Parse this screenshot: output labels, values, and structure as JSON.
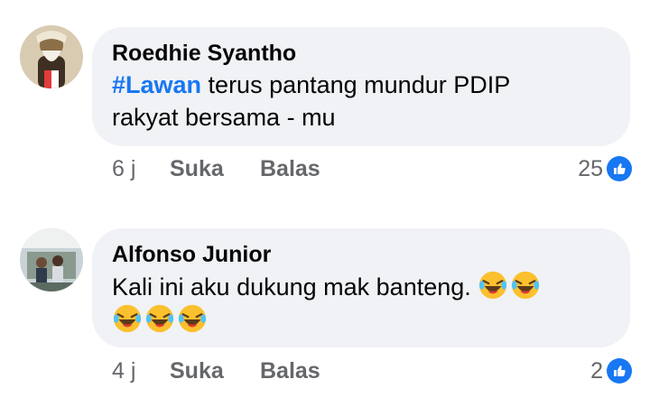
{
  "comments": [
    {
      "author": "Roedhie Syantho",
      "hashtag": "#Lawan",
      "text_line1": " terus pantang mundur PDIP",
      "text_line2": "rakyat bersama - mu",
      "time": "6 j",
      "like_label": "Suka",
      "reply_label": "Balas",
      "reaction_count": "25",
      "reaction_icon": "like-icon"
    },
    {
      "author": "Alfonso Junior",
      "text_line1": "Kali ini aku dukung mak banteng.",
      "time": "4 j",
      "like_label": "Suka",
      "reply_label": "Balas",
      "reaction_count": "2",
      "reaction_icon": "like-icon",
      "emojis": [
        "laughing-crying-emoji",
        "laughing-crying-emoji",
        "laughing-crying-emoji",
        "laughing-crying-emoji",
        "laughing-crying-emoji"
      ]
    }
  ],
  "colors": {
    "bubble": "#f0f2f5",
    "hashtag": "#1877f2",
    "meta": "#65676b",
    "like_badge": "#1877f2"
  }
}
